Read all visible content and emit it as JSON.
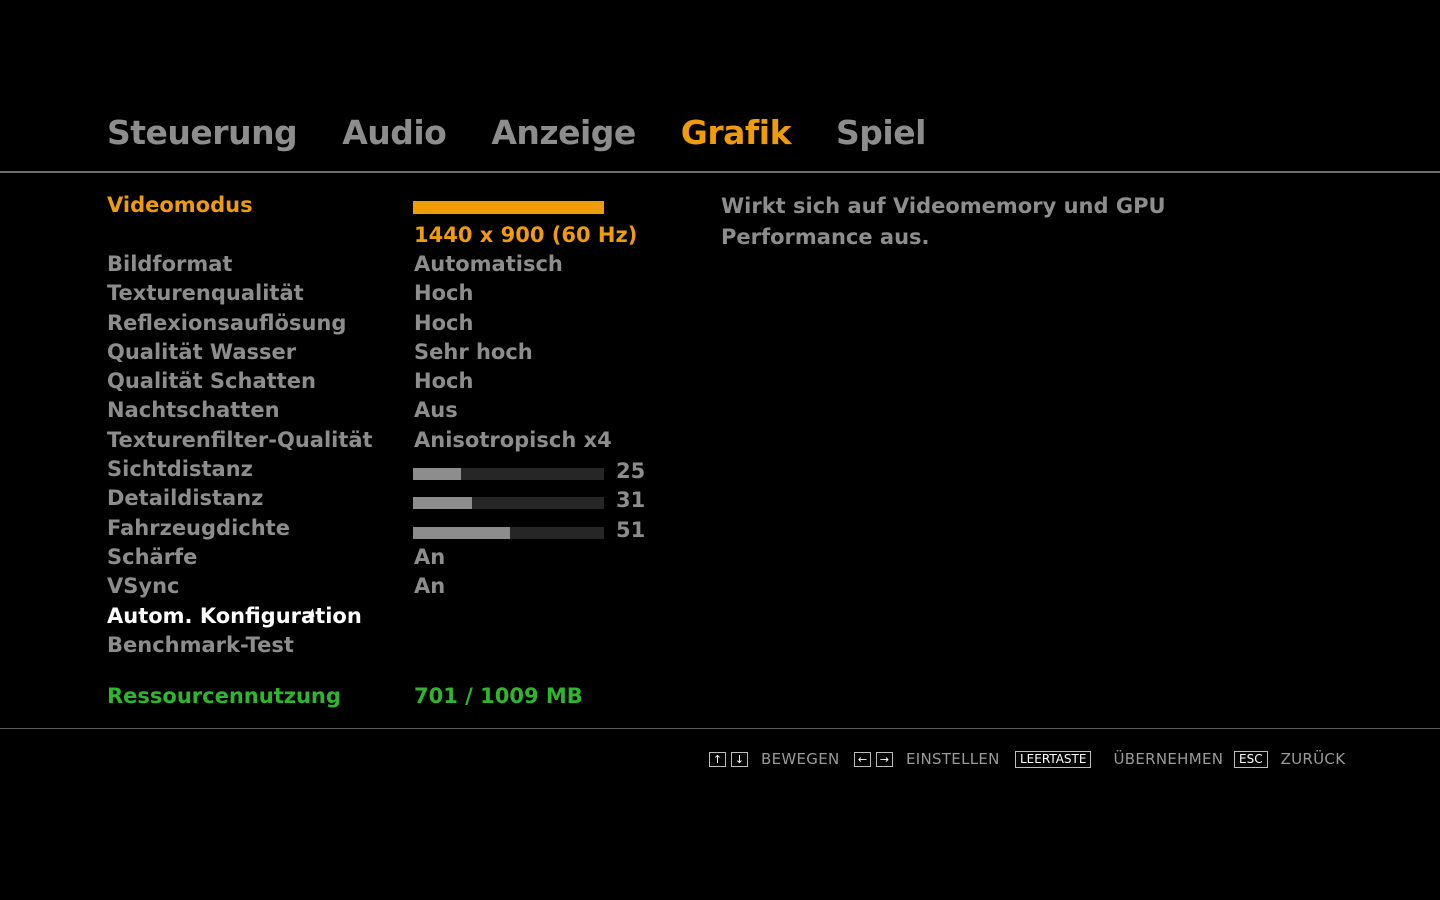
{
  "tabs": [
    {
      "label": "Steuerung"
    },
    {
      "label": "Audio"
    },
    {
      "label": "Anzeige"
    },
    {
      "label": "Grafik",
      "active": true
    },
    {
      "label": "Spiel"
    }
  ],
  "settings": {
    "videomodus": {
      "label": "Videomodus",
      "value": "1440 x 900 (60 Hz)"
    },
    "bildformat": {
      "label": "Bildformat",
      "value": "Automatisch"
    },
    "texturenqualitaet": {
      "label": "Texturenqualität",
      "value": "Hoch"
    },
    "reflexionsaufloesung": {
      "label": "Reflexionsauflösung",
      "value": "Hoch"
    },
    "qualitaet_wasser": {
      "label": "Qualität Wasser",
      "value": "Sehr hoch"
    },
    "qualitaet_schatten": {
      "label": "Qualität Schatten",
      "value": "Hoch"
    },
    "nachtschatten": {
      "label": "Nachtschatten",
      "value": "Aus"
    },
    "texturenfilter": {
      "label": "Texturenfilter-Qualität",
      "value": "Anisotropisch x4"
    },
    "sichtdistanz": {
      "label": "Sichtdistanz",
      "value": "25",
      "level": 25
    },
    "detaildistanz": {
      "label": "Detaildistanz",
      "value": "31",
      "level": 31
    },
    "fahrzeugdichte": {
      "label": "Fahrzeugdichte",
      "value": "51",
      "level": 51
    },
    "schaerfe": {
      "label": "Schärfe",
      "value": "An"
    },
    "vsync": {
      "label": "VSync",
      "value": "An"
    },
    "autokonfig": {
      "label": "Autom. Konfiguration"
    },
    "benchmark": {
      "label": "Benchmark-Test"
    }
  },
  "resource": {
    "label": "Ressourcennutzung",
    "value": "701 / 1009 MB"
  },
  "description": "Wirkt sich auf Videomemory und GPU Performance aus.",
  "hints": {
    "move_keys": [
      "↑",
      "↓"
    ],
    "move_label": "BEWEGEN",
    "adjust_keys": [
      "←",
      "→"
    ],
    "adjust_label": "EINSTELLEN",
    "space_key": "LEERTASTE",
    "apply_label": "ÜBERNEHMEN",
    "esc_key": "ESC",
    "back_label": "ZURÜCK"
  },
  "colors": {
    "accent": "#f09c0a",
    "text": "#8d8d8d",
    "resource": "#2fb52e",
    "highlight": "#ffffff",
    "background": "#000000"
  }
}
